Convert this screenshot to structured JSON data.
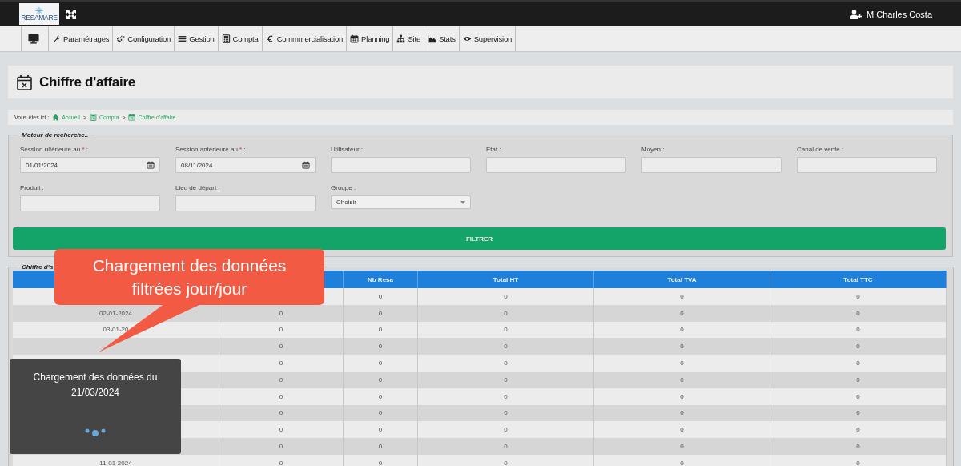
{
  "topbar": {
    "logo_text": "RESAMARE",
    "user": "M Charles Costa"
  },
  "nav": {
    "items": [
      {
        "kind": "icon"
      },
      {
        "label": "Paramétrages"
      },
      {
        "label": "Configuration"
      },
      {
        "label": "Gestion"
      },
      {
        "label": "Compta"
      },
      {
        "label": "Commmercialisation"
      },
      {
        "label": "Planning"
      },
      {
        "label": "Site"
      },
      {
        "label": "Stats"
      },
      {
        "label": "Supervision"
      }
    ]
  },
  "page_title": "Chiffre d'affaire",
  "breadcrumb": {
    "label": "Vous êtes ici :",
    "separator": ">",
    "items": [
      "Accueil",
      "Compta",
      "Chiffre d'affaire"
    ]
  },
  "search": {
    "legend": "Moteur de recherche..",
    "fields": [
      {
        "label": "Session ultérieure au",
        "required_mark": "*",
        "label_end": ":",
        "kind": "date",
        "value": "01/01/2024"
      },
      {
        "label": "Session antérieure au",
        "required_mark": "*",
        "label_end": ":",
        "kind": "date",
        "value": "08/11/2024"
      },
      {
        "label": "Utilisateur :",
        "kind": "text"
      },
      {
        "label": "Etat :",
        "kind": "text"
      },
      {
        "label": "Moyen :",
        "kind": "text"
      },
      {
        "label": "Canal de vente :",
        "kind": "text"
      },
      {
        "label": "Produit :",
        "kind": "text"
      },
      {
        "label": "Lieu de départ :",
        "kind": "text"
      },
      {
        "label": "Groupe :",
        "kind": "select",
        "value": "Choisir"
      }
    ],
    "button": "FILTRER"
  },
  "results": {
    "legend": "Chiffre d'a",
    "columns": [
      {},
      {},
      {
        "label": "Nb Resa"
      },
      {
        "label": "Total HT"
      },
      {
        "label": "Total TVA"
      },
      {
        "label": "Total TTC"
      }
    ],
    "rows": [
      [
        null,
        null,
        "0",
        "0",
        "0",
        "0"
      ],
      [
        "02-01-2024",
        "0",
        "0",
        "0",
        "0",
        "0"
      ],
      [
        "03-01-20",
        "0",
        "0",
        "0",
        "0",
        "0"
      ],
      [
        null,
        "0",
        "0",
        "0",
        "0",
        "0"
      ],
      [
        null,
        "0",
        "0",
        "0",
        "0",
        "0"
      ],
      [
        null,
        "0",
        "0",
        "0",
        "0",
        "0"
      ],
      [
        null,
        "0",
        "0",
        "0",
        "0",
        "0"
      ],
      [
        null,
        "0",
        "0",
        "0",
        "0",
        "0"
      ],
      [
        null,
        "0",
        "0",
        "0",
        "0",
        "0"
      ],
      [
        null,
        "0",
        "0",
        "0",
        "0",
        "0"
      ],
      [
        "11-01-2024",
        "0",
        "0",
        "0",
        "0",
        "0"
      ]
    ]
  },
  "callout": {
    "text": "Chargement des données filtrées jour/jour"
  },
  "toast": {
    "text": "Chargement des données du 21/03/2024"
  }
}
